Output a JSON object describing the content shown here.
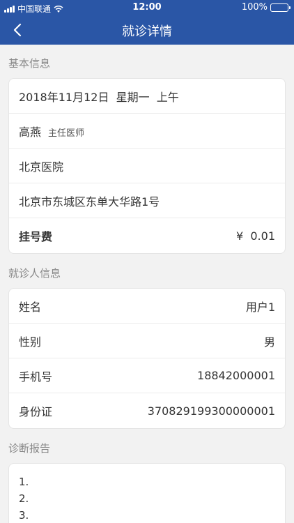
{
  "status_bar": {
    "carrier": "中国联通",
    "time": "12:00",
    "battery": "100%",
    "battery_level": 1.0
  },
  "navbar": {
    "title": "就诊详情",
    "back_icon": "chevron-left-icon"
  },
  "basic_info": {
    "title": "基本信息",
    "date": "2018年11月12日  星期一  上午",
    "doctor_name": "高燕",
    "doctor_title": "主任医师",
    "hospital": "北京医院",
    "address": "北京市东城区东单大华路1号",
    "fee_label": "挂号费",
    "fee_value": "¥  0.01"
  },
  "patient_info": {
    "title": "就诊人信息",
    "rows": [
      {
        "label": "姓名",
        "value": "用户1"
      },
      {
        "label": "性别",
        "value": "男"
      },
      {
        "label": "手机号",
        "value": "18842000001"
      },
      {
        "label": "身份证",
        "value": "370829199300000001"
      }
    ]
  },
  "diagnosis": {
    "title": "诊断报告",
    "items": [
      "1.",
      "2.",
      "3."
    ]
  },
  "colors": {
    "header": "#2a56a6",
    "background": "#f2f2f2",
    "battery": "#3ecb3e"
  }
}
